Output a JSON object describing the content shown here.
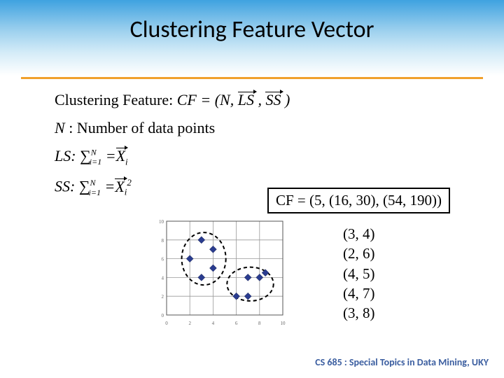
{
  "title": "Clustering Feature Vector",
  "def_prefix": "Clustering Feature:  ",
  "def_cf": "CF = (N, ",
  "def_ls": "LS",
  "def_sep": ", ",
  "def_ss": "SS",
  "def_close": ")",
  "n_line_prefix": "N",
  "n_line_rest": ": Number of data points",
  "ls_label": "LS:  ",
  "ss_label": "SS:  ",
  "sum_sym": "∑",
  "sum_upper": "N",
  "sum_lower": "i=1",
  "eq": "=",
  "x_var": "X",
  "x_sub": "i",
  "x_sup2": "2",
  "cf_box": "CF = (5, (16, 30), (54, 190))",
  "points": [
    "(3, 4)",
    "(2, 6)",
    "(4, 5)",
    "(4, 7)",
    "(3, 8)"
  ],
  "footer": "CS 685 : Special Topics in Data Mining, UKY",
  "chart_data": {
    "type": "scatter",
    "x_range": [
      0,
      10
    ],
    "y_range": [
      0,
      10
    ],
    "grid": true,
    "clusters": [
      {
        "points": [
          [
            3,
            4
          ],
          [
            2,
            6
          ],
          [
            4,
            5
          ],
          [
            4,
            7
          ],
          [
            3,
            8
          ]
        ],
        "ellipse": {
          "cx": 3.2,
          "cy": 6,
          "rx": 1.9,
          "ry": 2.8
        }
      },
      {
        "points": [
          [
            6,
            2
          ],
          [
            7,
            2
          ],
          [
            7,
            4
          ],
          [
            8,
            4
          ],
          [
            8.5,
            4.5
          ]
        ],
        "ellipse": {
          "cx": 7.2,
          "cy": 3.3,
          "rx": 2.0,
          "ry": 1.8
        }
      }
    ]
  }
}
